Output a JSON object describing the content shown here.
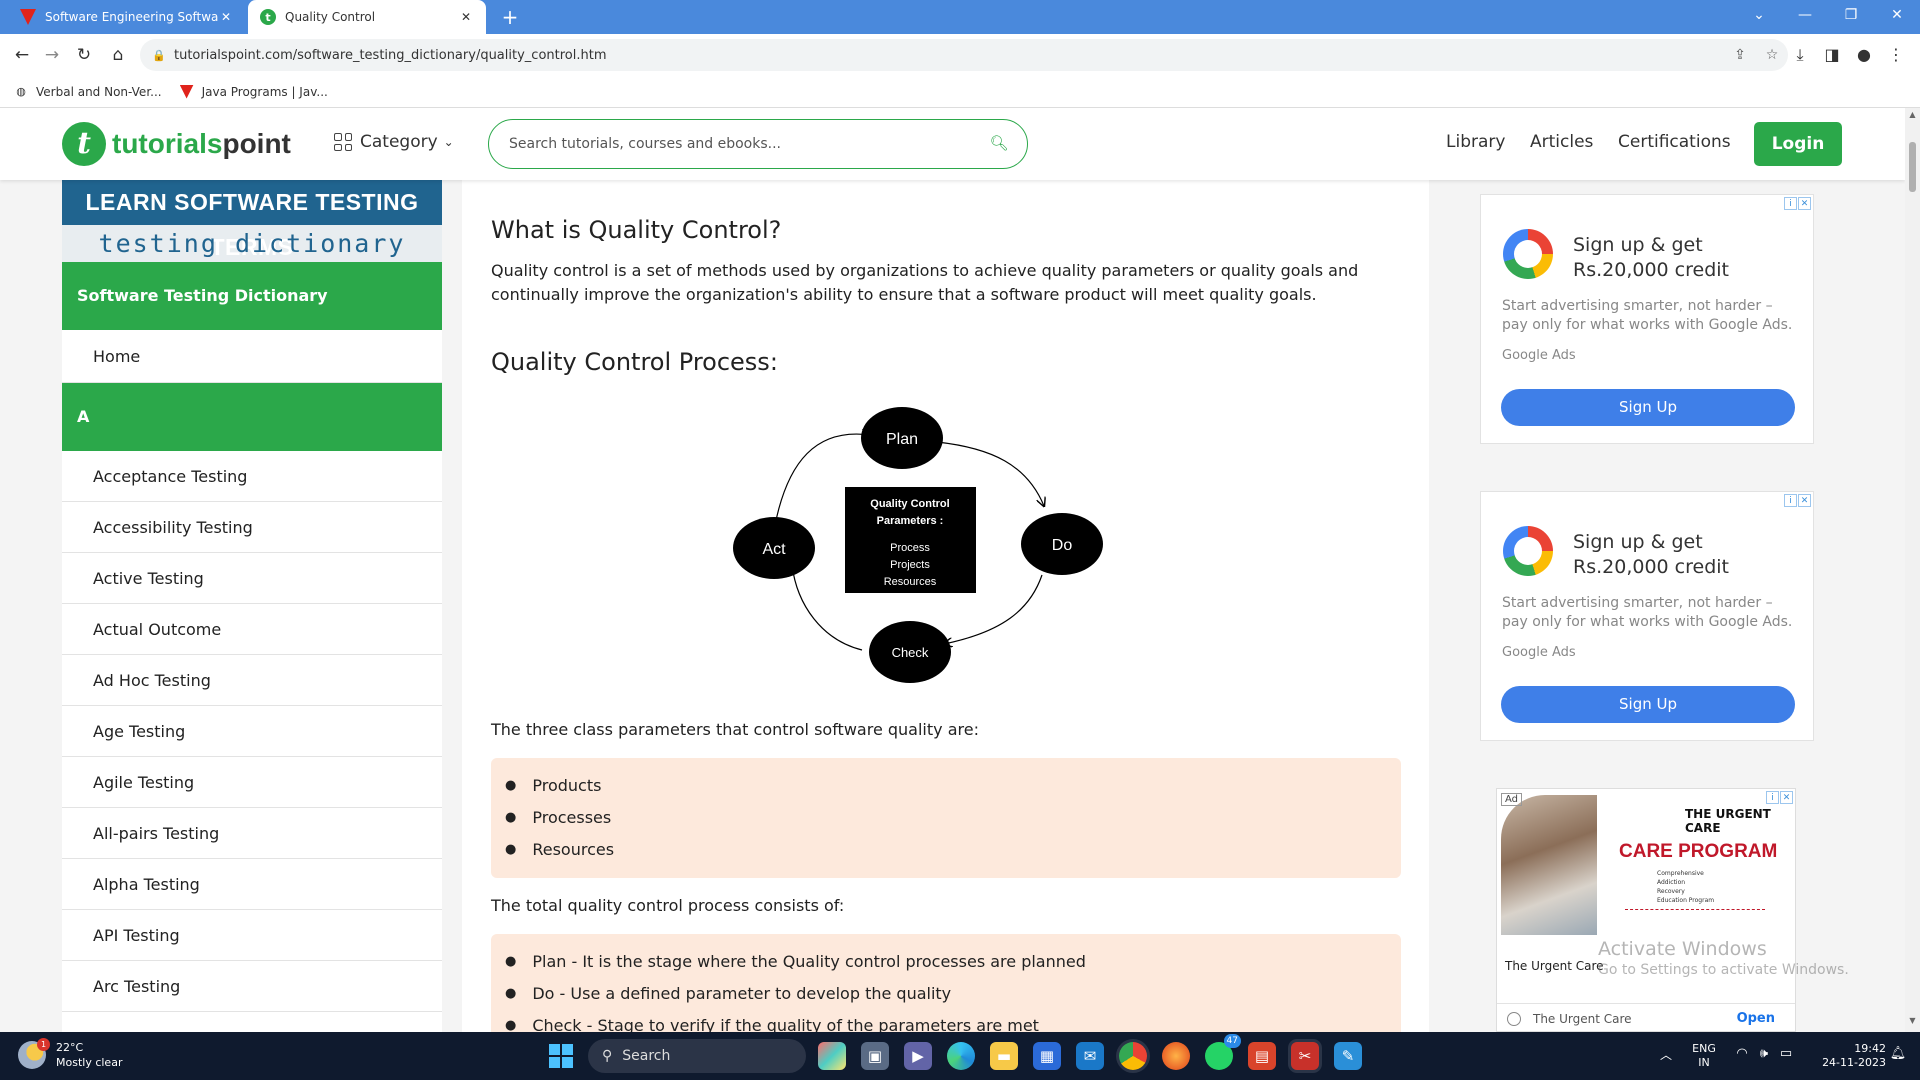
{
  "browser": {
    "tabs": [
      {
        "title": "Software Engineering Software",
        "active": false
      },
      {
        "title": "Quality Control",
        "active": true
      }
    ],
    "url": "tutorialspoint.com/software_testing_dictionary/quality_control.htm",
    "bookmarks": [
      "Verbal and Non-Ver...",
      "Java Programs | Jav..."
    ]
  },
  "header": {
    "logo_brand": "tutorials",
    "logo_suffix": "point",
    "category_label": "Category",
    "search_placeholder": "Search tutorials, courses and ebooks...",
    "nav": [
      "Library",
      "Articles",
      "Certifications"
    ],
    "login_label": "Login",
    "accent_color": "#2ba84a"
  },
  "sidebar": {
    "banner_top": "LEARN SOFTWARE TESTING TERMS",
    "banner_bottom": "testing dictionary",
    "section_title": "Software Testing Dictionary",
    "home_label": "Home",
    "letter_heading": "A",
    "items": [
      "Acceptance Testing",
      "Accessibility Testing",
      "Active Testing",
      "Actual Outcome",
      "Ad Hoc Testing",
      "Age Testing",
      "Agile Testing",
      "All-pairs Testing",
      "Alpha Testing",
      "API Testing",
      "Arc Testing"
    ]
  },
  "article": {
    "title": "What is Quality Control?",
    "intro": "Quality control is a set of methods used by organizations to achieve quality parameters or quality goals and continually improve the organization's ability to ensure that a software product will meet quality goals.",
    "process_heading": "Quality Control Process:",
    "diagram": {
      "nodes": [
        "Plan",
        "Do",
        "Check",
        "Act"
      ],
      "center_title": "Quality Control Parameters :",
      "center_items": [
        "Process",
        "Projects",
        "Resources"
      ]
    },
    "params_intro": "The three class parameters that control software quality are:",
    "params": [
      "Products",
      "Processes",
      "Resources"
    ],
    "process_intro": "The total quality control process consists of:",
    "steps": [
      "Plan - It is the stage where the Quality control processes are planned",
      "Do - Use a defined parameter to develop the quality",
      "Check - Stage to verify if the quality of the parameters are met"
    ]
  },
  "ads": [
    {
      "headline": "Sign up & get Rs.20,000 credit",
      "body": "Start advertising smarter, not harder – pay only for what works with Google Ads.",
      "source": "Google Ads",
      "cta": "Sign Up"
    },
    {
      "headline": "Sign up & get Rs.20,000 credit",
      "body": "Start advertising smarter, not harder – pay only for what works with Google Ads.",
      "source": "Google Ads",
      "cta": "Sign Up"
    }
  ],
  "ad3": {
    "tag": "Ad",
    "brand": "THE URGENT CARE",
    "program": "CARE PROGRAM",
    "program_lines": [
      "Comprehensive",
      "Addiction",
      "Recovery",
      "Education Program"
    ],
    "advertiser": "The Urgent Care",
    "footer_name": "The Urgent Care",
    "open_label": "Open"
  },
  "watermark": {
    "line1": "Activate Windows",
    "line2": "Go to Settings to activate Windows."
  },
  "taskbar": {
    "weather_temp": "22°C",
    "weather_desc": "Mostly clear",
    "weather_badge": "1",
    "search_label": "Search",
    "whatsapp_badge": "47",
    "lang_line1": "ENG",
    "lang_line2": "IN",
    "time": "19:42",
    "date": "24-11-2023"
  }
}
